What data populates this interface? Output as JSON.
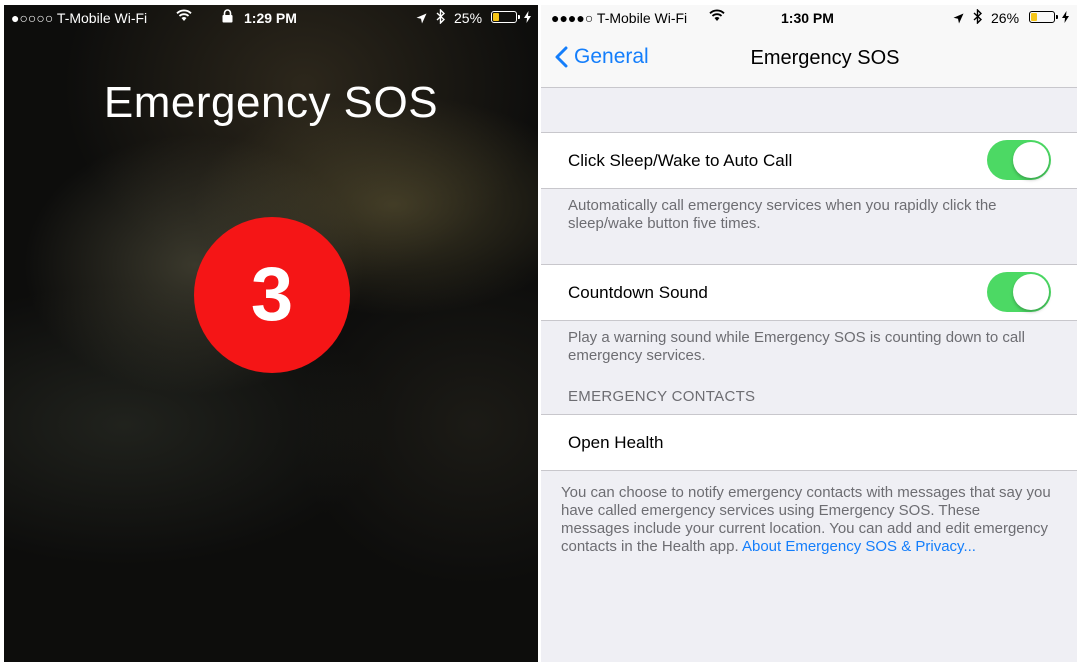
{
  "left_screen": {
    "status_bar": {
      "carrier": "●○○○○ T-Mobile Wi-Fi",
      "time": "1:29 PM",
      "battery_percent": "25%",
      "battery_level": 0.25
    },
    "title": "Emergency SOS",
    "countdown": "3",
    "countdown_color": "#f51516"
  },
  "right_screen": {
    "status_bar": {
      "carrier": "●●●●○ T-Mobile Wi-Fi",
      "time": "1:30 PM",
      "battery_percent": "26%",
      "battery_level": 0.26
    },
    "nav": {
      "back_label": "General",
      "title": "Emergency SOS"
    },
    "auto_call": {
      "label": "Click Sleep/Wake to Auto Call",
      "enabled": true,
      "footer": "Automatically call emergency services when you rapidly click the sleep/wake button five times."
    },
    "countdown_sound": {
      "label": "Countdown Sound",
      "enabled": true,
      "footer": "Play a warning sound while Emergency SOS is counting down to call emergency services."
    },
    "contacts_header": "EMERGENCY CONTACTS",
    "open_health": "Open Health",
    "contacts_footer": "You can choose to notify emergency contacts with messages that say you have called emergency services using Emergency SOS. These messages include your current location. You can add and edit emergency contacts in the Health app.",
    "privacy_link": "About Emergency SOS & Privacy..."
  },
  "colors": {
    "accent": "#147efb",
    "toggle_on": "#4cd964",
    "battery": "#f5c518"
  },
  "icons": [
    "wifi-icon",
    "lock-icon",
    "location-arrow-icon",
    "bluetooth-icon",
    "battery-icon",
    "charging-bolt-icon",
    "chevron-left-icon"
  ]
}
